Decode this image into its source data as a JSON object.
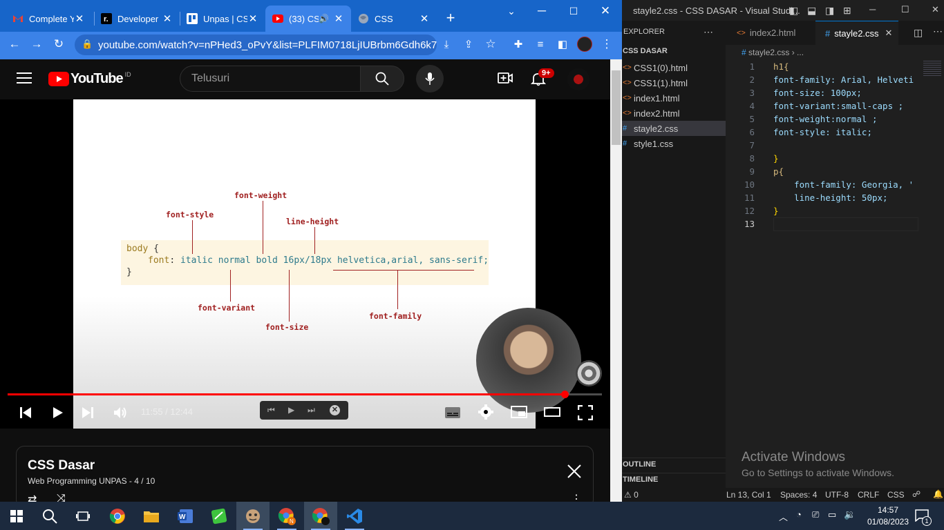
{
  "browser": {
    "tabs": [
      {
        "label": "Complete Y",
        "icon": "gmail-icon"
      },
      {
        "label": "Developer I",
        "icon": "dev-icon"
      },
      {
        "label": "Unpas | CSS",
        "icon": "trello-icon"
      },
      {
        "label": "(33) CS",
        "icon": "youtube-icon"
      },
      {
        "label": "CSS",
        "icon": "globe-icon"
      }
    ],
    "url": "youtube.com/watch?v=nPHed3_oPvY&list=PLFIM0718LjIUBrbm6Gdh6k7ZUv..."
  },
  "youtube": {
    "logo_text": "YouTube",
    "region": "ID",
    "search_placeholder": "Telusuri",
    "notification_count": "9+",
    "time": "11:55 / 12:44",
    "progress": 0.937,
    "slide": {
      "code_line1_selector": "body",
      "code_line1_brace": " {",
      "code_line2_prop": "font",
      "code_line2_value": "italic normal bold 16px/18px helvetica,arial, sans-serif;",
      "code_line3": "}",
      "labels": {
        "font_weight": "font-weight",
        "font_style": "font-style",
        "line_height": "line-height",
        "font_variant": "font-variant",
        "font_size": "font-size",
        "font_family": "font-family"
      }
    },
    "playlist": {
      "title": "CSS Dasar",
      "subtitle": "Web Programming UNPAS - 4 / 10"
    }
  },
  "vscode": {
    "window_title": "stayle2.css - CSS DASAR - Visual Studi...",
    "explorer_label": "EXPLORER",
    "folder": "CSS DASAR",
    "files": [
      {
        "name": "CSS1(0).html",
        "icon": "html-icon"
      },
      {
        "name": "CSS1(1).html",
        "icon": "html-icon"
      },
      {
        "name": "index1.html",
        "icon": "html-icon"
      },
      {
        "name": "index2.html",
        "icon": "html-icon"
      },
      {
        "name": "stayle2.css",
        "icon": "css-icon"
      },
      {
        "name": "style1.css",
        "icon": "css-icon"
      }
    ],
    "outline_label": "OUTLINE",
    "timeline_label": "TIMELINE",
    "tabs": [
      {
        "label": "index2.html"
      },
      {
        "label": "stayle2.css"
      }
    ],
    "breadcrumb": "stayle2.css",
    "breadcrumb_more": "...",
    "code": [
      {
        "n": "1",
        "text": "h1{"
      },
      {
        "n": "2",
        "text": "font-family: Arial, Helveti"
      },
      {
        "n": "3",
        "text": "font-size: 100px;"
      },
      {
        "n": "4",
        "text": "font-variant:small-caps ;"
      },
      {
        "n": "5",
        "text": "font-weight:normal ;"
      },
      {
        "n": "6",
        "text": "font-style: italic;"
      },
      {
        "n": "7",
        "text": ""
      },
      {
        "n": "8",
        "text": "}"
      },
      {
        "n": "9",
        "text": "p{"
      },
      {
        "n": "10",
        "text": "    font-family: Georgia, '"
      },
      {
        "n": "11",
        "text": "    line-height: 50px;"
      },
      {
        "n": "12",
        "text": "}"
      },
      {
        "n": "13",
        "text": ""
      }
    ],
    "watermark_title": "Activate Windows",
    "watermark_sub": "Go to Settings to activate Windows.",
    "status": {
      "problems": "0",
      "position": "Ln 13, Col 1",
      "spaces": "Spaces: 4",
      "encoding": "UTF-8",
      "eol": "CRLF",
      "language": "CSS"
    }
  },
  "taskbar": {
    "time": "14:57",
    "date": "01/08/2023",
    "notifications": "1",
    "apps": [
      "windows-start",
      "search",
      "task-view",
      "chrome",
      "file-explorer",
      "word",
      "notepad-plus",
      "game",
      "chrome-profile-n",
      "chrome-profile-2",
      "vscode"
    ]
  }
}
